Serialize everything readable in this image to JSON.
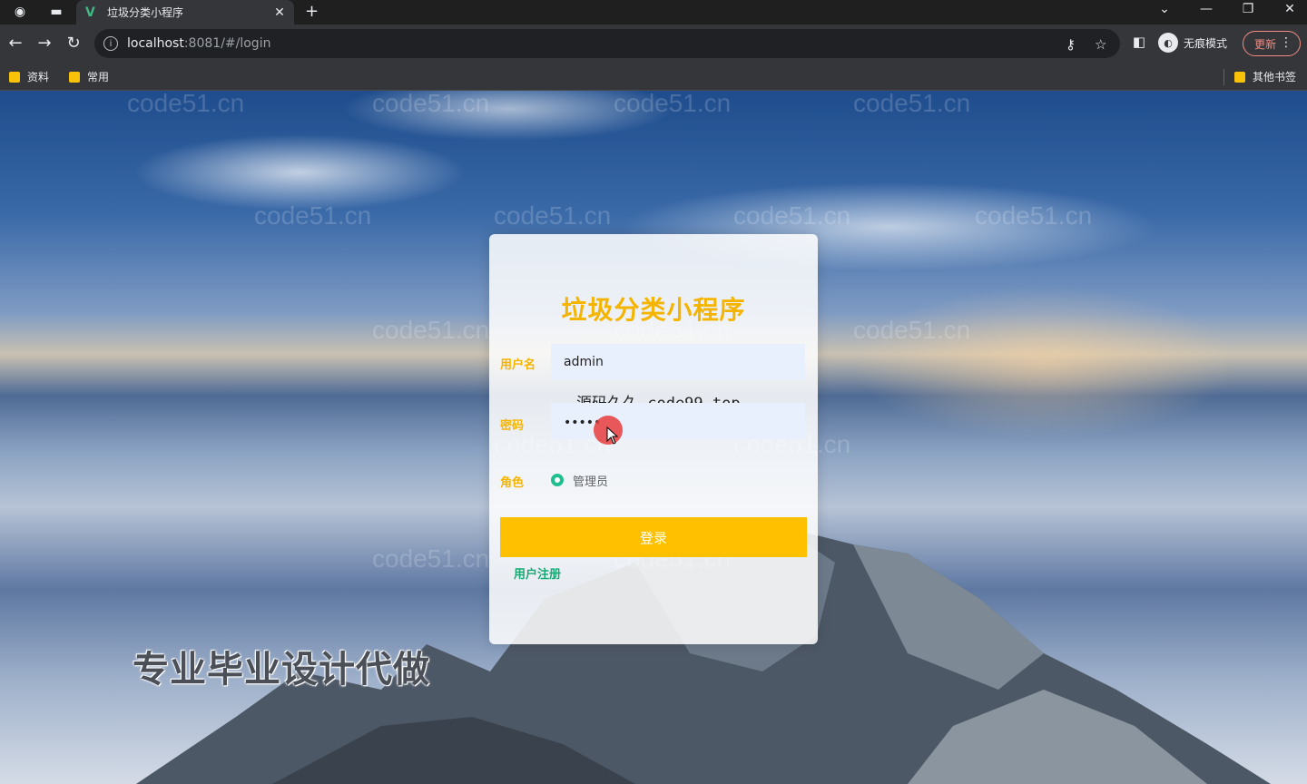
{
  "browser": {
    "tab_title": "垃圾分类小程序",
    "tab_favicon": "V",
    "url_host": "localhost",
    "url_rest": ":8081/#/login",
    "incognito_label": "无痕模式",
    "update_label": "更新",
    "bookmarks": [
      "资料",
      "常用"
    ],
    "other_bookmarks": "其他书签"
  },
  "login": {
    "title": "垃圾分类小程序",
    "username_label": "用户名",
    "username_value": "admin",
    "password_label": "密码",
    "password_value": "•••••",
    "role_label": "角色",
    "role_option": "管理员",
    "login_button": "登录",
    "register_link": "用户注册"
  },
  "overlay_text": "源码久久-code99.top",
  "promo_text": "专业毕业设计代做",
  "watermark_text": "code51.cn",
  "colors": {
    "accent": "#f5b400",
    "button": "#ffc000",
    "link": "#19a974",
    "radio": "#1fbf8f"
  }
}
